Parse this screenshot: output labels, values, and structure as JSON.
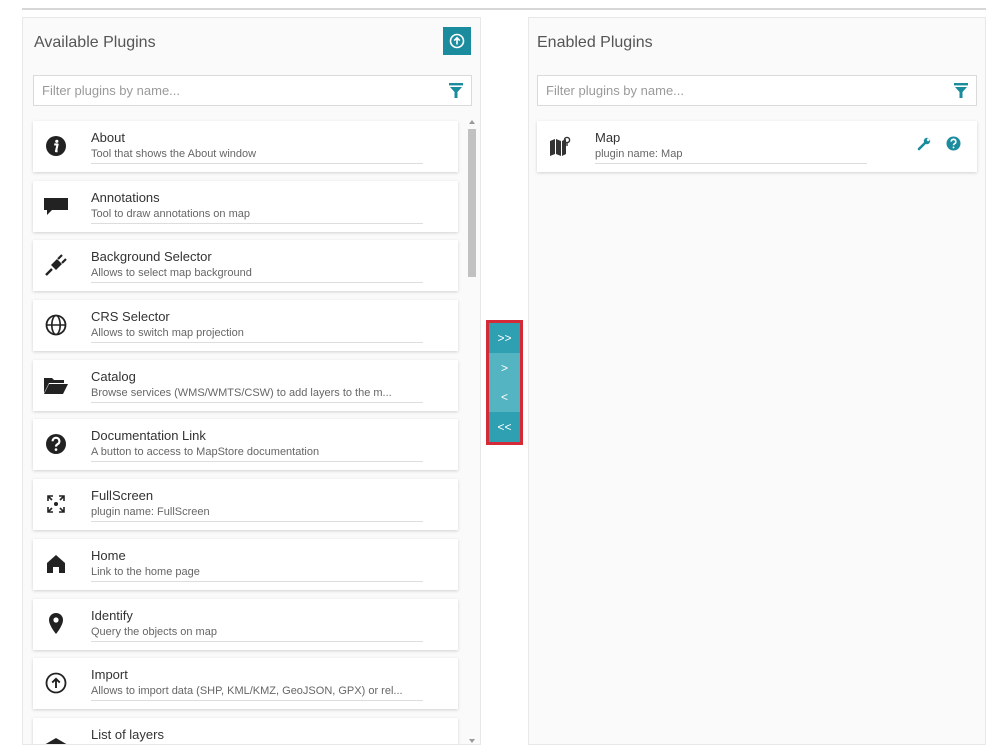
{
  "available": {
    "title": "Available Plugins",
    "filter_placeholder": "Filter plugins by name...",
    "plugins": [
      {
        "name": "About",
        "description": "Tool that shows the About window",
        "icon": "info-circle-icon"
      },
      {
        "name": "Annotations",
        "description": "Tool to draw annotations on map",
        "icon": "comment-icon"
      },
      {
        "name": "Background Selector",
        "description": "Allows to select map background",
        "icon": "plug-icon"
      },
      {
        "name": "CRS Selector",
        "description": "Allows to switch map projection",
        "icon": "globe-icon"
      },
      {
        "name": "Catalog",
        "description": "Browse services (WMS/WMTS/CSW) to add layers to the m...",
        "icon": "folder-open-icon"
      },
      {
        "name": "Documentation Link",
        "description": "A button to access to MapStore documentation",
        "icon": "question-circle-icon"
      },
      {
        "name": "FullScreen",
        "description": "plugin name: FullScreen",
        "icon": "expand-icon"
      },
      {
        "name": "Home",
        "description": "Link to the home page",
        "icon": "home-icon"
      },
      {
        "name": "Identify",
        "description": "Query the objects on map",
        "icon": "map-marker-icon"
      },
      {
        "name": "Import",
        "description": "Allows to import data (SHP, KML/KMZ, GeoJSON, GPX) or rel...",
        "icon": "upload-circle-icon"
      },
      {
        "name": "List of layers",
        "description": "",
        "icon": "layers-icon"
      }
    ]
  },
  "enabled": {
    "title": "Enabled Plugins",
    "filter_placeholder": "Filter plugins by name...",
    "plugins": [
      {
        "name": "Map",
        "description": "plugin name: Map",
        "icon": "map-icon"
      }
    ]
  },
  "transfer_buttons": [
    ">>",
    ">",
    "<",
    "<<"
  ],
  "colors": {
    "accent": "#1b8c9e",
    "transfer_dark": "#2f9fb2",
    "transfer_light": "#55b4c2",
    "highlight": "#d52b38"
  }
}
